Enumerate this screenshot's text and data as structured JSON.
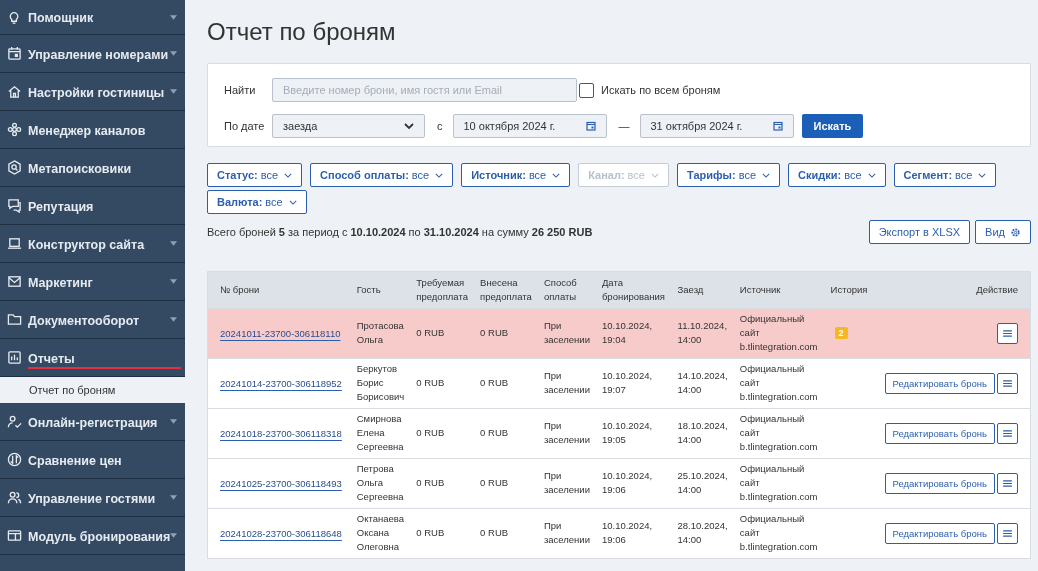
{
  "sidebar": {
    "items": [
      {
        "label": "Помощник",
        "has_submenu": true,
        "selected": false
      },
      {
        "label": "Управление номерами",
        "has_submenu": true,
        "selected": false
      },
      {
        "label": "Настройки гостиницы",
        "has_submenu": true,
        "selected": false
      },
      {
        "label": "Менеджер каналов",
        "has_submenu": false,
        "selected": false
      },
      {
        "label": "Метапоисковики",
        "has_submenu": false,
        "selected": false
      },
      {
        "label": "Репутация",
        "has_submenu": false,
        "selected": false
      },
      {
        "label": "Конструктор сайта",
        "has_submenu": true,
        "selected": false
      },
      {
        "label": "Маркетинг",
        "has_submenu": true,
        "selected": false
      },
      {
        "label": "Документооборот",
        "has_submenu": true,
        "selected": false
      },
      {
        "label": "Отчеты",
        "has_submenu": false,
        "selected": true,
        "children": [
          {
            "label": "Отчет по броням"
          }
        ]
      },
      {
        "label": "Онлайн-регистрация",
        "has_submenu": true,
        "selected": false
      },
      {
        "label": "Сравнение цен",
        "has_submenu": false,
        "selected": false
      },
      {
        "label": "Управление гостями",
        "has_submenu": true,
        "selected": false
      },
      {
        "label": "Модуль бронирования",
        "has_submenu": true,
        "selected": false
      }
    ]
  },
  "title": "Отчет по броням",
  "search": {
    "label": "Найти",
    "placeholder": "Введите номер брони, имя гостя или Email",
    "all_label": "Искать по всем броням",
    "all_checked": false,
    "date_label": "По дате",
    "date_type": "заезда",
    "from_label": "с",
    "from": "10 октября 2024 г.",
    "dash": "—",
    "to": "31 октября 2024 г.",
    "button": "Искать"
  },
  "filters": [
    {
      "label": "Статус:",
      "value": "все",
      "disabled": false
    },
    {
      "label": "Способ оплаты:",
      "value": "все",
      "disabled": false
    },
    {
      "label": "Источник:",
      "value": "все",
      "disabled": false
    },
    {
      "label": "Канал:",
      "value": "все",
      "disabled": true
    },
    {
      "label": "Тарифы:",
      "value": "все",
      "disabled": false
    },
    {
      "label": "Скидки:",
      "value": "все",
      "disabled": false
    },
    {
      "label": "Сегмент:",
      "value": "все",
      "disabled": false
    },
    {
      "label": "Валюта:",
      "value": "все",
      "disabled": false
    }
  ],
  "summary": "Всего броней **5** за период с **10.10.2024** по **31.10.2024** на сумму **26 250 RUB**",
  "export_button": "Экспорт в XLSX",
  "view_button": "Вид",
  "table": {
    "columns": [
      "№ брони",
      "Гость",
      "Требуемая предоплата",
      "Внесена предоплата",
      "Способ оплаты",
      "Дата бронирования",
      "Заезд",
      "Источник",
      "История",
      "Действие"
    ],
    "rows": [
      {
        "number": "20241011-23700-306118110",
        "guest": "Протасова Ольга",
        "required": "0 RUB",
        "paid": "0 RUB",
        "payment": "При заселении",
        "booked": "10.10.2024, 19:04",
        "checkin": "11.10.2024, 14:00",
        "source": "Официальный сайт b.tlintegration.com",
        "history": "2",
        "highlighted": true
      },
      {
        "number": "20241014-23700-306118952",
        "guest": "Беркутов Борис Борисович",
        "required": "0 RUB",
        "paid": "0 RUB",
        "payment": "При заселении",
        "booked": "10.10.2024, 19:07",
        "checkin": "14.10.2024, 14:00",
        "source": "Официальный сайт b.tlintegration.com",
        "edit": "Редактировать бронь",
        "highlighted": false
      },
      {
        "number": "20241018-23700-306118318",
        "guest": "Смирнова Елена Сергеевна",
        "required": "0 RUB",
        "paid": "0 RUB",
        "payment": "При заселении",
        "booked": "10.10.2024, 19:05",
        "checkin": "18.10.2024, 14:00",
        "source": "Официальный сайт b.tlintegration.com",
        "edit": "Редактировать бронь",
        "highlighted": false
      },
      {
        "number": "20241025-23700-306118493",
        "guest": "Петрова Ольга Сергеевна",
        "required": "0 RUB",
        "paid": "0 RUB",
        "payment": "При заселении",
        "booked": "10.10.2024, 19:06",
        "checkin": "25.10.2024, 14:00",
        "source": "Официальный сайт b.tlintegration.com",
        "edit": "Редактировать бронь",
        "highlighted": false
      },
      {
        "number": "20241028-23700-306118648",
        "guest": "Октанаева Оксана Олеговна",
        "required": "0 RUB",
        "paid": "0 RUB",
        "payment": "При заселении",
        "booked": "10.10.2024, 19:06",
        "checkin": "28.10.2024, 14:00",
        "source": "Официальный сайт b.tlintegration.com",
        "edit": "Редактировать бронь",
        "highlighted": false
      }
    ]
  }
}
